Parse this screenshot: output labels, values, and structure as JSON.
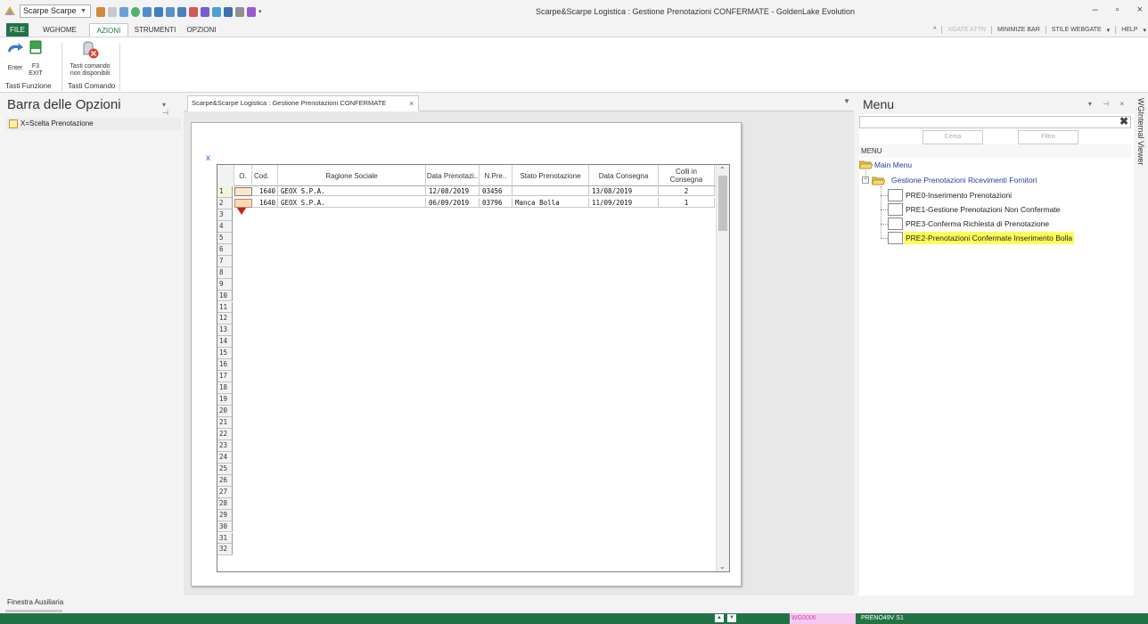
{
  "titlebar": {
    "combo_value": "Scarpe Scarpe",
    "window_title": "Scarpe&Scarpe Logistica : Gestione Prenotazioni   CONFERMATE  - GoldenLake Evolution",
    "minimize": "–",
    "maximize": "▫",
    "close": "×"
  },
  "ribbon_tabs": {
    "file": "FILE",
    "wghome": "WGHOME",
    "azioni": "AZIONI",
    "strumenti": "STRUMENTI",
    "opzioni": "OPZIONI"
  },
  "ribbon_right": {
    "caret": "^",
    "xgate": "XGATE ATTN",
    "minimize_bar": "MINIMIZE BAR",
    "stile": "STILE WEBGATE",
    "help": "HELP"
  },
  "ribbon": {
    "enter_label": "Enter",
    "f3_label": "F3",
    "f3_sub": "EXIT",
    "tasti_cmd_label": "Tasti comando",
    "tasti_cmd_sub": "non disponibili",
    "group1": "Tasti Funzione",
    "group2": "Tasti Comando"
  },
  "left_panel": {
    "title": "Barra delle Opzioni",
    "pin": "▾ ⊣",
    "item": "X=Scelta Prenotazione"
  },
  "doc_tab": {
    "label": "Scarpe&Scarpe Logistica : Gestione Prenotazioni   CONFERMATE",
    "close": "×",
    "menu": "▼"
  },
  "form": {
    "x_marker": "x"
  },
  "grid": {
    "headers": {
      "o": "O.",
      "cod": "Cod.",
      "ragione": "Ragione Sociale",
      "data_pren": "Data Prenotazi..",
      "npre": "N.Pre..",
      "stato": "Stato Prenotazione",
      "data_cons": "Data Consegna",
      "colli": "Colli in Consegna"
    },
    "rows": [
      {
        "cod": "1640",
        "ragione": "GEOX S.P.A.",
        "data_pren": "12/08/2019",
        "npre": "03456",
        "stato": "",
        "data_cons": "13/08/2019",
        "colli": "2"
      },
      {
        "cod": "1640",
        "ragione": "GEOX S.P.A.",
        "data_pren": "06/09/2019",
        "npre": "03796",
        "stato": "Manca Bolla",
        "data_cons": "11/09/2019",
        "colli": "1"
      }
    ],
    "row_numbers": [
      "1",
      "2",
      "3",
      "4",
      "5",
      "6",
      "7",
      "8",
      "9",
      "10",
      "11",
      "12",
      "13",
      "14",
      "15",
      "16",
      "17",
      "18",
      "19",
      "20",
      "21",
      "22",
      "23",
      "24",
      "25",
      "26",
      "27",
      "28",
      "29",
      "30",
      "31",
      "32"
    ]
  },
  "menu_panel": {
    "title": "Menu",
    "ctrls": "▾ ⊣ ×",
    "search_value": "",
    "clear": "✖",
    "cerca": "Cerca",
    "filtra": "Filtra",
    "sub_label": "MENU",
    "main_menu": "Main Menu",
    "group": "Gestione Prenotazioni Ricevimenti Fornitori",
    "items": [
      "PRE0-Inserimento Prenotazioni",
      "PRE1-Gestione Prenotazioni Non Confermate",
      "PRE3-Conferma Richiesta di Prenotazione",
      "PRE2-Prenotazioni Confermate Inserimento Bolla"
    ]
  },
  "side_tab": "WGInternal Viewer",
  "aux": {
    "label": "Finestra Ausiliaria"
  },
  "statusbar": {
    "up": "▲",
    "down": "▼",
    "field": "WG0006",
    "program": "PRENO49V   S1"
  },
  "colors": {
    "accent_green": "#217346",
    "highlight_yellow": "#ffff5a",
    "status_pink": "#f7c9ee"
  }
}
